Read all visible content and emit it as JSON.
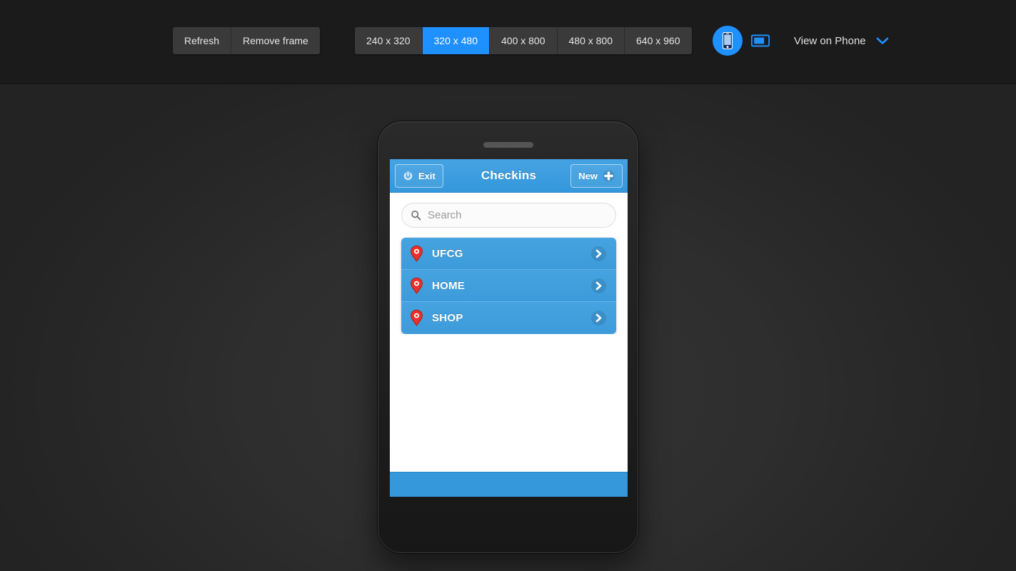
{
  "toolbar": {
    "frame_actions": [
      {
        "label": "Refresh",
        "name": "refresh-button",
        "active": false
      },
      {
        "label": "Remove frame",
        "name": "remove-frame-button",
        "active": false
      }
    ],
    "size_presets": [
      {
        "label": "240 x 320",
        "name": "size-preset-240x320",
        "active": false
      },
      {
        "label": "320 x 480",
        "name": "size-preset-320x480",
        "active": true
      },
      {
        "label": "400 x 800",
        "name": "size-preset-400x800",
        "active": false
      },
      {
        "label": "480 x 800",
        "name": "size-preset-480x800",
        "active": false
      },
      {
        "label": "640 x 960",
        "name": "size-preset-640x960",
        "active": false
      }
    ],
    "orientation": {
      "portrait_icon": "phone-portrait-icon",
      "landscape_icon": "phone-landscape-icon",
      "selected": "portrait"
    },
    "view_on_phone": {
      "label": "View on Phone",
      "chevron_icon": "chevron-down-icon"
    },
    "colors": {
      "accent": "#1e90ff",
      "toolbar_bg": "#1b1b1b",
      "button_bg": "#3a3a3a"
    }
  },
  "app": {
    "header": {
      "exit_label": "Exit",
      "exit_icon": "power-icon",
      "title": "Checkins",
      "new_label": "New",
      "new_icon": "plus-icon"
    },
    "search": {
      "placeholder": "Search",
      "value": "",
      "icon": "search-icon"
    },
    "list": [
      {
        "label": "UFCG",
        "pin_icon": "map-pin-icon",
        "chevron_icon": "chevron-right-icon"
      },
      {
        "label": "HOME",
        "pin_icon": "map-pin-icon",
        "chevron_icon": "chevron-right-icon"
      },
      {
        "label": "SHOP",
        "pin_icon": "map-pin-icon",
        "chevron_icon": "chevron-right-icon"
      }
    ],
    "colors": {
      "header_bg": "#3498db",
      "list_item_bg": "#3d9bdb",
      "pin_color": "#e8312a",
      "footer_bg": "#3498db"
    }
  },
  "device": {
    "speaker": "speaker-grille"
  }
}
